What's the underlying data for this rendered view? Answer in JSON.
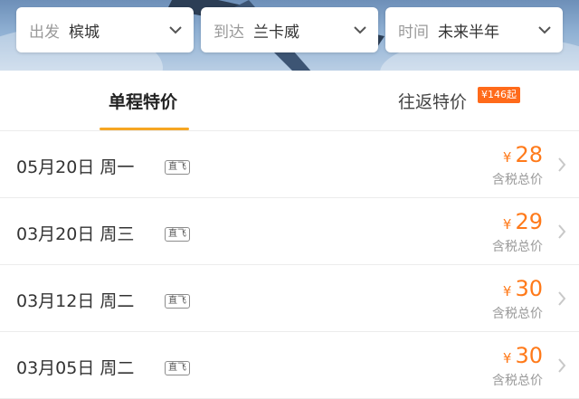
{
  "filters": [
    {
      "key": "出发",
      "value": "槟城"
    },
    {
      "key": "到达",
      "value": "兰卡威"
    },
    {
      "key": "时间",
      "value": "未来半年"
    }
  ],
  "tabs": {
    "one_way": "单程特价",
    "round_trip": "往返特价",
    "round_trip_badge": "¥146起",
    "active": "one_way"
  },
  "flights": [
    {
      "date": "05月20日 周一",
      "tag": "直飞",
      "currency": "¥",
      "price": "28",
      "note": "含税总价"
    },
    {
      "date": "03月20日 周三",
      "tag": "直飞",
      "currency": "¥",
      "price": "29",
      "note": "含税总价"
    },
    {
      "date": "03月12日 周二",
      "tag": "直飞",
      "currency": "¥",
      "price": "30",
      "note": "含税总价"
    },
    {
      "date": "03月05日 周二",
      "tag": "直飞",
      "currency": "¥",
      "price": "30",
      "note": "含税总价"
    }
  ],
  "colors": {
    "accent": "#f6a623",
    "price": "#ff7a1a",
    "badge": "#ff6a1a"
  },
  "icons": {
    "dropdown": "chevron-down-icon",
    "row": "chevron-right-icon"
  }
}
